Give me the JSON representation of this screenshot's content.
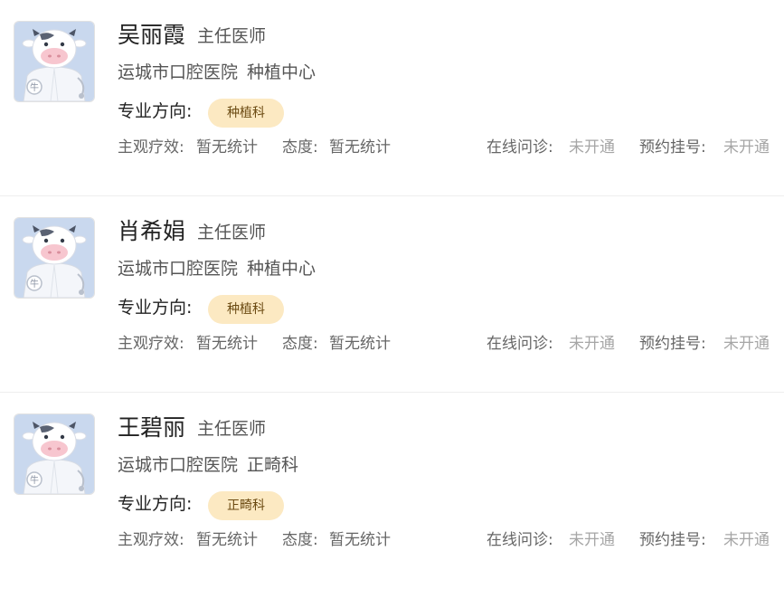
{
  "doctors": [
    {
      "name": "吴丽霞",
      "title": "主任医师",
      "hospital": "运城市口腔医院",
      "department": "种植中心",
      "specialty_label": "专业方向:",
      "specialty_tag": "种植科",
      "efficacy_label": "主观疗效:",
      "efficacy_value": "暂无统计",
      "attitude_label": "态度:",
      "attitude_value": "暂无统计",
      "online_label": "在线问诊:",
      "online_value": "未开通",
      "appointment_label": "预约挂号:",
      "appointment_value": "未开通"
    },
    {
      "name": "肖希娟",
      "title": "主任医师",
      "hospital": "运城市口腔医院",
      "department": "种植中心",
      "specialty_label": "专业方向:",
      "specialty_tag": "种植科",
      "efficacy_label": "主观疗效:",
      "efficacy_value": "暂无统计",
      "attitude_label": "态度:",
      "attitude_value": "暂无统计",
      "online_label": "在线问诊:",
      "online_value": "未开通",
      "appointment_label": "预约挂号:",
      "appointment_value": "未开通"
    },
    {
      "name": "王碧丽",
      "title": "主任医师",
      "hospital": "运城市口腔医院",
      "department": "正畸科",
      "specialty_label": "专业方向:",
      "specialty_tag": "正畸科",
      "efficacy_label": "主观疗效:",
      "efficacy_value": "暂无统计",
      "attitude_label": "态度:",
      "attitude_value": "暂无统计",
      "online_label": "在线问诊:",
      "online_value": "未开通",
      "appointment_label": "预约挂号:",
      "appointment_value": "未开通"
    }
  ],
  "avatar": {
    "icon": "cow-doctor-avatar-icon",
    "badge_text": "牛",
    "background": "#c9d8ee",
    "face": "#f7c6cf"
  },
  "colors": {
    "tag_background": "#fce9c2",
    "tag_text": "#6b4a12",
    "muted_value": "#a6a6a6",
    "divider": "#eeeeee"
  }
}
